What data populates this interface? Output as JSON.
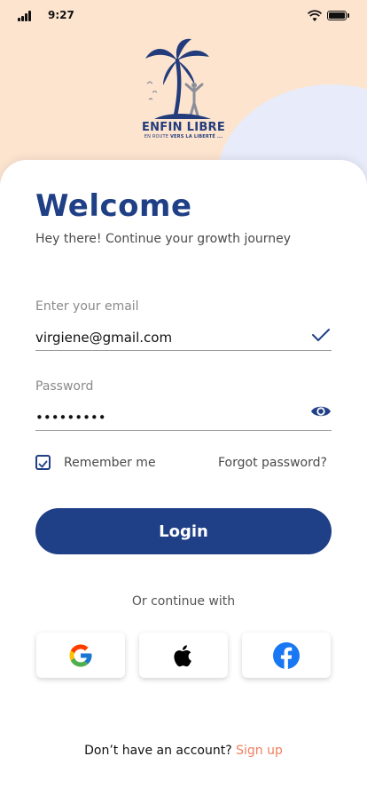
{
  "status_bar": {
    "time": "9:27"
  },
  "brand": {
    "name": "ENFIN LIBRE",
    "tagline_prefix": "EN ROUTE",
    "tagline_bold": "VERS LA LIBERTÉ ..."
  },
  "header": {
    "title": "Welcome",
    "subtitle": "Hey there! Continue your growth journey"
  },
  "form": {
    "email_label": "Enter your email",
    "email_value": "virgiene@gmail.com",
    "password_label": "Password",
    "password_value": "•••••••••",
    "remember_label": "Remember me",
    "remember_checked": true,
    "forgot_label": "Forgot password?",
    "login_label": "Login"
  },
  "social": {
    "divider_text": "Or continue with",
    "providers": [
      {
        "name": "Google",
        "icon": "google-icon"
      },
      {
        "name": "Apple",
        "icon": "apple-icon"
      },
      {
        "name": "Facebook",
        "icon": "facebook-icon"
      }
    ]
  },
  "footer": {
    "prompt": "Don’t have an account?",
    "signup_label": "Sign up"
  },
  "colors": {
    "primary": "#1f3f86",
    "accent": "#f08060",
    "background_top": "#fde4cf"
  }
}
